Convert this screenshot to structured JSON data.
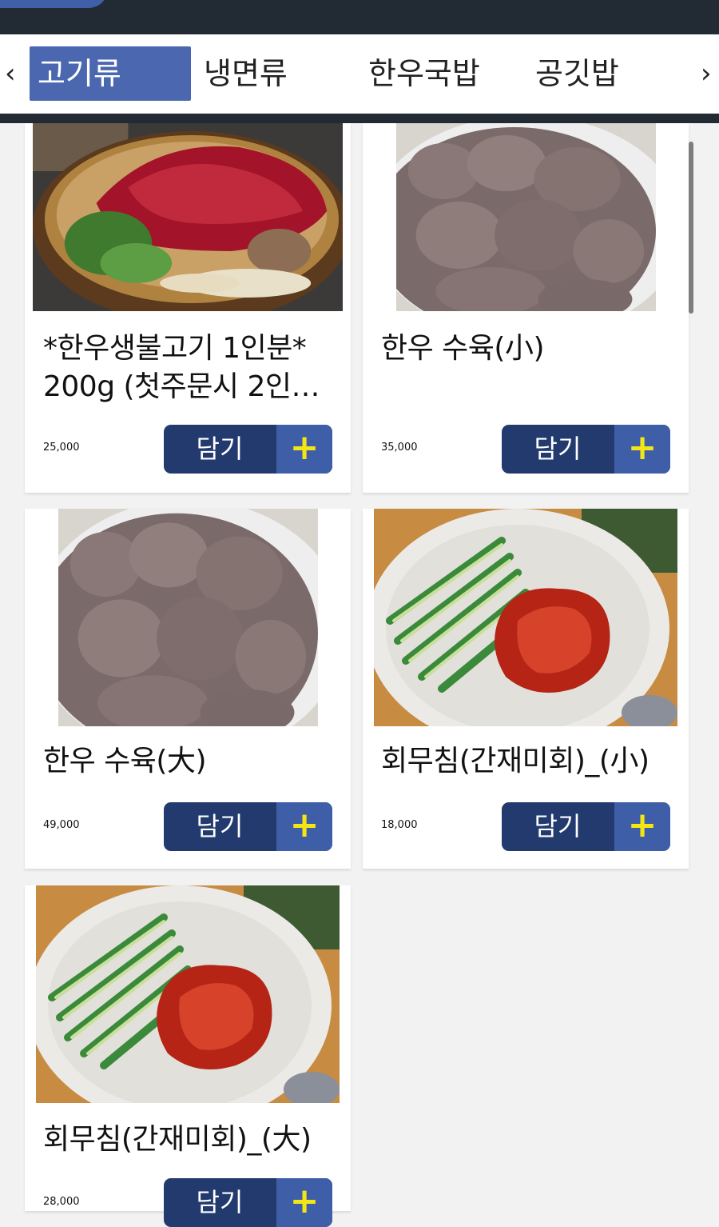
{
  "tabs": {
    "prev_icon": "chevron-left-icon",
    "next_icon": "chevron-right-icon",
    "items": [
      {
        "label": "고기류",
        "active": true
      },
      {
        "label": "냉면류"
      },
      {
        "label": "한우국밥"
      },
      {
        "label": "공깃밥"
      }
    ]
  },
  "colors": {
    "header_bg": "#222a33",
    "active_tab": "#4a67b0",
    "button_bg": "#223a6e",
    "button_plus_bg": "#3e5ea8",
    "plus_icon": "#f4e515"
  },
  "menu": [
    {
      "name_line1": "*한우생불고기 1인분*",
      "name_line2": "200g (첫주문시 2인…",
      "price": "25,000",
      "button": "담기",
      "photo": "bulgogi-hotpot-photo"
    },
    {
      "name_line1": "한우 수육(小)",
      "name_line2": "",
      "price": "35,000",
      "button": "담기",
      "photo": "beef-suyuk-photo"
    },
    {
      "name_line1": "한우 수육(大)",
      "name_line2": "",
      "price": "49,000",
      "button": "담기",
      "photo": "beef-suyuk-photo"
    },
    {
      "name_line1": "회무침(간재미회)_(小)",
      "name_line2": "",
      "price": "18,000",
      "button": "담기",
      "photo": "spicy-raw-fish-salad-photo"
    },
    {
      "name_line1": "회무침(간재미회)_(大)",
      "name_line2": "",
      "price": "28,000",
      "button": "담기",
      "photo": "spicy-raw-fish-salad-photo"
    }
  ]
}
